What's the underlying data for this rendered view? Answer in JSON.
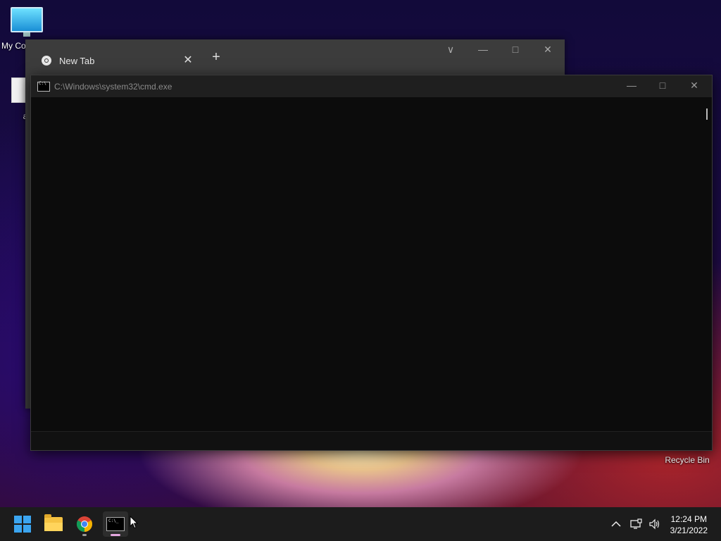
{
  "desktop": {
    "icons": [
      {
        "label": "My Co"
      },
      {
        "label": "a.l"
      },
      {
        "label": "Recycle Bin"
      }
    ]
  },
  "chrome": {
    "tab_title": "New Tab",
    "new_tab_symbol": "+",
    "close_symbol": "✕"
  },
  "cmd": {
    "title": "C:\\Windows\\system32\\cmd.exe"
  },
  "taskbar": {
    "time": "12:24 PM",
    "date": "3/21/2022",
    "accent": "#3ba5f0",
    "active_indicator": "#e5a7e0"
  }
}
